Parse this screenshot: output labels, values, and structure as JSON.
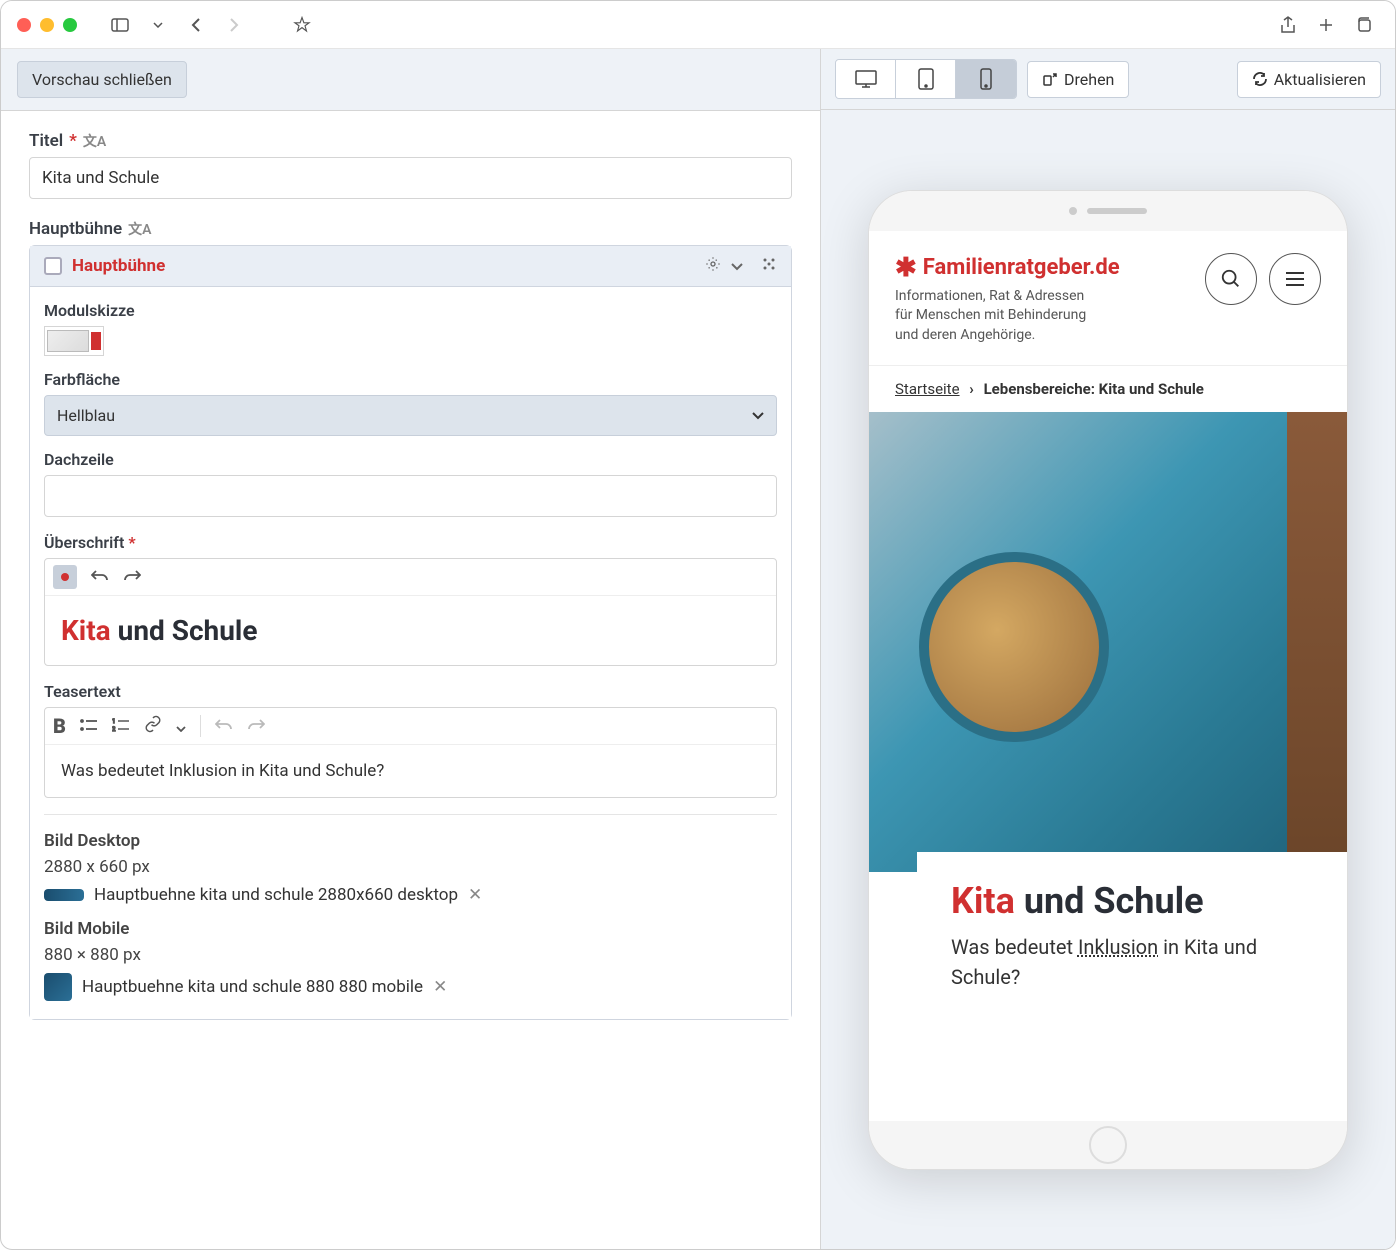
{
  "toolbar": {
    "close_preview": "Vorschau schließen",
    "rotate": "Drehen",
    "refresh": "Aktualisieren"
  },
  "form": {
    "title_label": "Titel",
    "title_value": "Kita und Schule",
    "main_stage_label": "Hauptbühne",
    "card": {
      "title": "Hauptbühne",
      "module_sketch_label": "Modulskizze",
      "color_area_label": "Farbfläche",
      "color_value": "Hellblau",
      "kicker_label": "Dachzeile",
      "kicker_value": "",
      "headline_label": "Überschrift",
      "headline_red": "Kita",
      "headline_black": " und Schule",
      "teaser_label": "Teasertext",
      "teaser_value": "Was bedeutet Inklusion in Kita und Schule?",
      "image_desktop_label": "Bild Desktop",
      "image_desktop_dim": "2880 x 660 px",
      "image_desktop_name": "Hauptbuehne kita und schule 2880x660 desktop",
      "image_mobile_label": "Bild Mobile",
      "image_mobile_dim": "880 × 880 px",
      "image_mobile_name": "Hauptbuehne kita und schule 880 880 mobile"
    }
  },
  "preview": {
    "brand": "Familienratgeber.de",
    "tagline": "Informationen, Rat & Adressen für Menschen mit Behinderung und deren Angehörige.",
    "breadcrumb_home": "Startseite",
    "breadcrumb_current": "Lebensbereiche: Kita und Schule",
    "hero_heading_red": "Kita",
    "hero_heading_black": " und Schule",
    "hero_teaser_pre": "Was bedeutet ",
    "hero_teaser_uline": "Inklusion",
    "hero_teaser_post": " in Kita und Schule?"
  }
}
